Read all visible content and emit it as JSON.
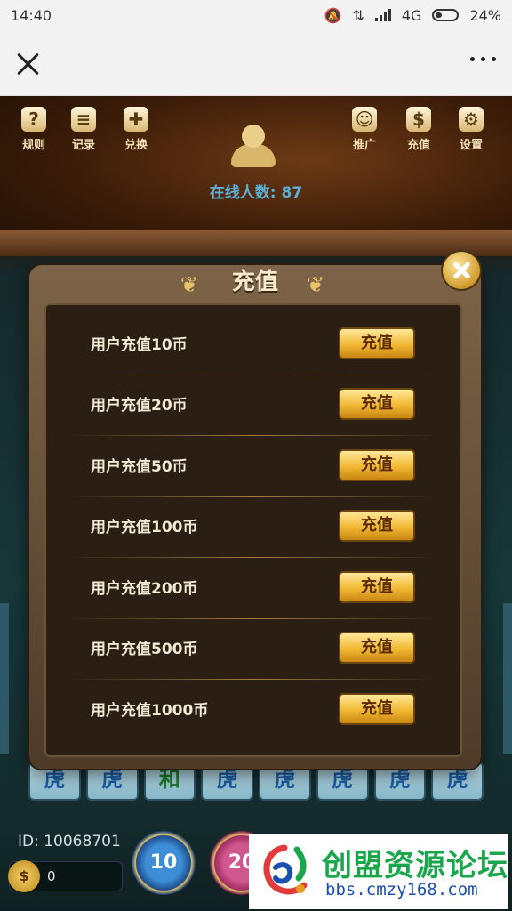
{
  "status": {
    "time": "14:40",
    "network": "4G",
    "battery": "24%"
  },
  "titlebar": {
    "close_icon": "close-icon",
    "more_icon": "more-icon"
  },
  "top_menu": [
    {
      "label": "规则",
      "icon": "question-icon",
      "glyph": "?"
    },
    {
      "label": "记录",
      "icon": "notepad-icon",
      "glyph": "≡"
    },
    {
      "label": "兑换",
      "icon": "gift-icon",
      "glyph": "✚"
    },
    {
      "label": "推广",
      "icon": "group-icon",
      "glyph": "☺"
    },
    {
      "label": "充值",
      "icon": "money-bag-icon",
      "glyph": "$"
    },
    {
      "label": "设置",
      "icon": "gear-icon",
      "glyph": "⚙"
    }
  ],
  "online": {
    "text": "在线人数: 87"
  },
  "modal": {
    "title": "充值",
    "items": [
      {
        "label": "用户充值10币",
        "button": "充值"
      },
      {
        "label": "用户充值20币",
        "button": "充值"
      },
      {
        "label": "用户充值50币",
        "button": "充值"
      },
      {
        "label": "用户充值100币",
        "button": "充值"
      },
      {
        "label": "用户充值200币",
        "button": "充值"
      },
      {
        "label": "用户充值500币",
        "button": "充值"
      },
      {
        "label": "用户充值1000币",
        "button": "充值"
      }
    ]
  },
  "tiles": [
    "虎",
    "虎",
    "和",
    "虎",
    "虎",
    "虎",
    "虎",
    "虎"
  ],
  "bottom": {
    "user_id": "ID: 10068701",
    "coin_value": "0",
    "chip1": "10",
    "chip2": "20"
  },
  "watermark": {
    "title": "创盟资源论坛",
    "url": "bbs.cmzy168.com"
  }
}
